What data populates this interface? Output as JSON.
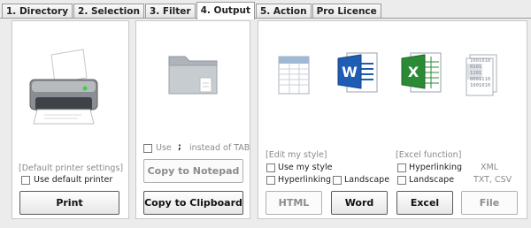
{
  "tabs": [
    {
      "label": "1. Directory"
    },
    {
      "label": "2. Selection"
    },
    {
      "label": "3. Filter"
    },
    {
      "label": "4. Output"
    },
    {
      "label": "5. Action"
    },
    {
      "label": "Pro Licence"
    }
  ],
  "active_tab": 3,
  "print_panel": {
    "hint": "[Default printer settings]",
    "use_default_label": "Use default printer",
    "print_button": "Print"
  },
  "copy_panel": {
    "use_label": "Use",
    "separator_symbol": ";",
    "instead_label": "instead of TAB",
    "notepad_button": "Copy to Notepad",
    "clipboard_button": "Copy to Clipboard"
  },
  "export_panel": {
    "edit_style_hint": "[Edit my style]",
    "use_my_style_label": "Use my style",
    "hyperlinking_label": "Hyperlinking",
    "landscape_label": "Landscape",
    "excel_function_hint": "[Excel function]",
    "excel_hyperlinking_label": "Hyperlinking",
    "excel_landscape_label": "Landscape",
    "xml_label": "XML",
    "txt_csv_label": "TXT, CSV",
    "html_button": "HTML",
    "word_button": "Word",
    "excel_button": "Excel",
    "file_button": "File",
    "binary_text": [
      "1001010",
      "0101",
      "1101",
      "0001110",
      "1001010"
    ]
  },
  "icons": {
    "printer": "printer-icon",
    "folder": "folder-icon",
    "html": "html-table-icon",
    "word": "word-icon",
    "excel": "excel-icon",
    "file": "binary-file-icon"
  },
  "colors": {
    "word_blue": "#1f5cb4",
    "excel_green": "#2a8a36"
  }
}
